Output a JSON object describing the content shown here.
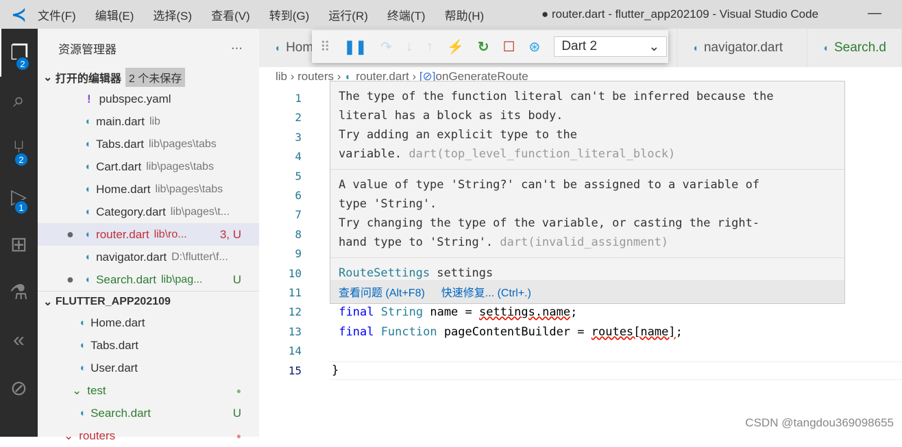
{
  "titlebar": {
    "menu": [
      "文件(F)",
      "编辑(E)",
      "选择(S)",
      "查看(V)",
      "转到(G)",
      "运行(R)",
      "终端(T)",
      "帮助(H)"
    ],
    "title": "● router.dart - flutter_app202109 - Visual Studio Code",
    "minimize": "—"
  },
  "activity": {
    "badges": {
      "explorer": "2",
      "scm": "2",
      "debug": "1"
    }
  },
  "sidebar": {
    "title": "资源管理器",
    "more": "···",
    "open_editors": "打开的编辑器",
    "unsaved": "2 个未保存",
    "open": [
      {
        "name": "pubspec.yaml",
        "desc": ""
      },
      {
        "name": "main.dart",
        "desc": "lib"
      },
      {
        "name": "Tabs.dart",
        "desc": "lib\\pages\\tabs"
      },
      {
        "name": "Cart.dart",
        "desc": "lib\\pages\\tabs"
      },
      {
        "name": "Home.dart",
        "desc": "lib\\pages\\tabs"
      },
      {
        "name": "Category.dart",
        "desc": "lib\\pages\\t..."
      },
      {
        "name": "router.dart",
        "desc": "lib\\ro...",
        "status": "3, U"
      },
      {
        "name": "navigator.dart",
        "desc": "D:\\flutter\\f..."
      },
      {
        "name": "Search.dart",
        "desc": "lib\\pag...",
        "status": "U"
      }
    ],
    "project": "FLUTTER_APP202109",
    "tree": [
      {
        "name": "Home.dart"
      },
      {
        "name": "Tabs.dart"
      },
      {
        "name": "User.dart"
      },
      {
        "name": "test"
      },
      {
        "name": "Search.dart",
        "status": "U"
      },
      {
        "name": "routers"
      }
    ]
  },
  "tabs": [
    "Hom",
    "navigator.dart",
    "Search.d"
  ],
  "debug": {
    "target": "Dart 2"
  },
  "breadcrumb": [
    "lib",
    "routers",
    "router.dart",
    "onGenerateRoute"
  ],
  "lines": [
    "1",
    "2",
    "3",
    "4",
    "5",
    "6",
    "7",
    "8",
    "9",
    "10",
    "11",
    "12",
    "13",
    "14",
    "15"
  ],
  "code": {
    "l12": {
      "kw": "final",
      "ty": "String",
      "a": " name = ",
      "b": "settings.name",
      ";": ";"
    },
    "l13": {
      "kw": "final",
      "ty": "Function",
      "a": " pageContentBuilder = ",
      "b": "routes[name]",
      "c": ";"
    },
    "l15": "}"
  },
  "hover": {
    "p1": [
      "The type of the function literal can't be inferred because the",
      "literal has a block as its body.",
      "Try adding an explicit type to the",
      "variable. "
    ],
    "p1src": "dart(top_level_function_literal_block)",
    "p2": [
      "A value of type 'String?' can't be assigned to a variable of",
      "type 'String'.",
      "Try changing the type of the variable, or casting the right-",
      "hand type to 'String'. "
    ],
    "p2src": "dart(invalid_assignment)",
    "sig_type": "RouteSettings",
    "sig_name": " settings",
    "view_problem": "查看问题 (Alt+F8)",
    "quick_fix": "快速修复... (Ctrl+.)"
  },
  "watermark": "CSDN @tangdou369098655"
}
